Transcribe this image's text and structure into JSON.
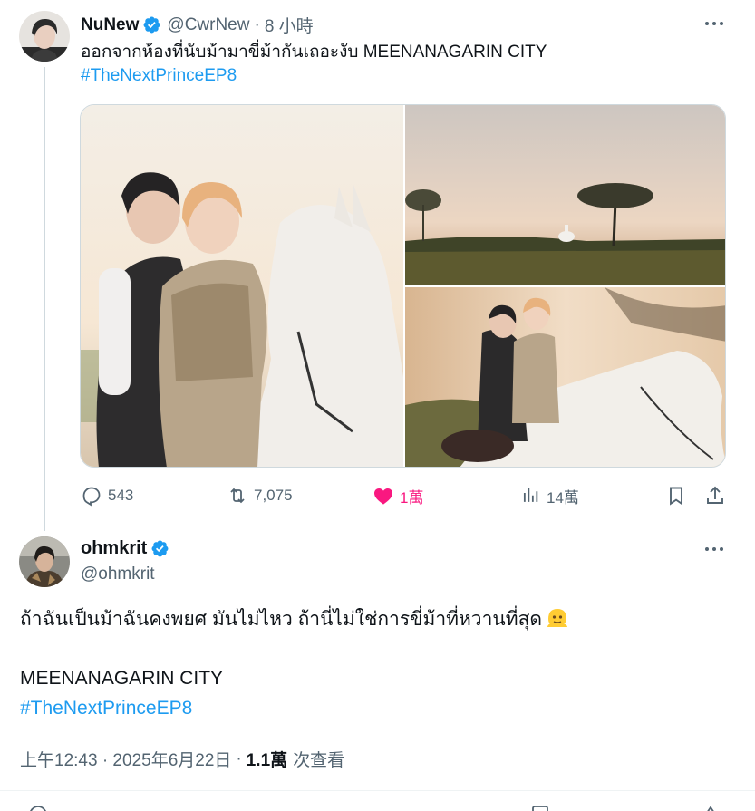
{
  "tweet1": {
    "name": "NuNew",
    "handle": "@CwrNew",
    "time": "8 小時",
    "text": "ออกจากห้องที่นับม้ามาขี่ม้ากันเถอะงับ MEENANAGARIN CITY",
    "hashtag": "#TheNextPrinceEP8",
    "stats": {
      "replies": "543",
      "retweets": "7,075",
      "likes": "1萬",
      "views": "14萬"
    },
    "colors": {
      "like": "#f91880",
      "link": "#1d9bf0",
      "muted": "#536471",
      "verified": "#1d9bf0"
    }
  },
  "tweet2": {
    "name": "ohmkrit",
    "handle": "@ohmkrit",
    "text": "ถ้าฉันเป็นม้าฉันคงพยศ มันไม่ไหว ถ้านี่ไม่ใช่การขี่ม้าที่หวานที่สุด",
    "emoji": "melting-face",
    "line2": "MEENANAGARIN CITY",
    "hashtag": "#TheNextPrinceEP8",
    "timestamp": "上午12:43 · 2025年6月22日",
    "views": "1.1萬",
    "views_label": "次查看"
  },
  "icons": [
    "verified-badge-icon",
    "more-icon",
    "reply-icon",
    "retweet-icon",
    "like-icon",
    "views-icon",
    "bookmark-icon",
    "share-icon"
  ]
}
